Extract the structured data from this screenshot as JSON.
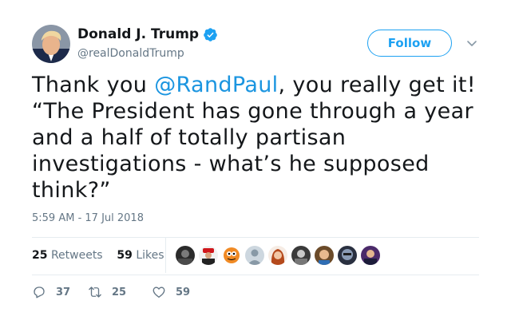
{
  "author": {
    "display_name": "Donald J. Trump",
    "handle": "@realDonaldTrump",
    "verified": true,
    "verified_icon": "verified-badge-icon"
  },
  "follow_button": {
    "label": "Follow"
  },
  "menu": {
    "icon": "chevron-down-icon"
  },
  "tweet": {
    "text_before": "Thank you ",
    "mention": "@RandPaul",
    "text_after": ", you really get it! “The President has gone through a year and a half of totally partisan investigations - what’s he supposed think?”"
  },
  "timestamp": "5:59 AM - 17 Jul 2018",
  "stats": {
    "retweets_count": "25",
    "retweets_label": "Retweets",
    "likes_count": "59",
    "likes_label": "Likes"
  },
  "actions": {
    "reply_count": "37",
    "retweet_count": "25",
    "like_count": "59"
  },
  "colors": {
    "accent": "#1da1f2",
    "mention": "#1b95e0",
    "muted": "#657786",
    "divider": "#e6ecf0"
  }
}
